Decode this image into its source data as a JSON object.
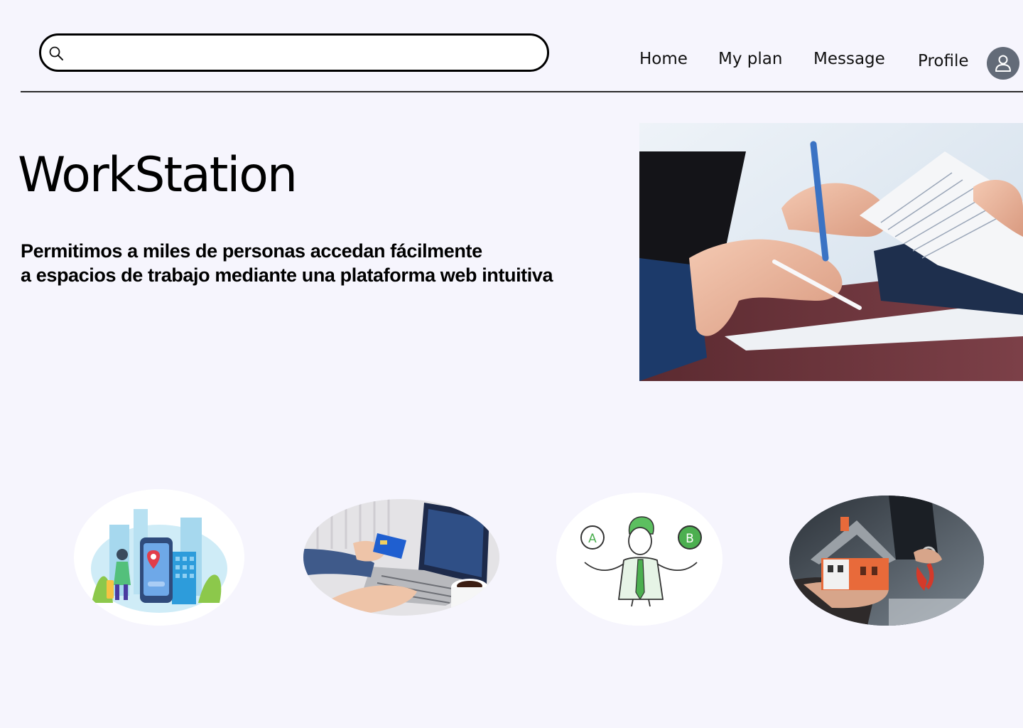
{
  "header": {
    "search": {
      "value": "",
      "placeholder": ""
    },
    "nav": {
      "home": "Home",
      "my_plan": "My plan",
      "message": "Message",
      "profile": "Profile"
    }
  },
  "hero": {
    "title": "WorkStation",
    "tagline_line1": "Permitimos a miles de personas accedan fácilmente",
    "tagline_line2": "a espacios de trabajo mediante una plataforma web intuitiva"
  },
  "features": [
    {
      "illustration": "location-map-illustration"
    },
    {
      "illustration": "online-payment-photo"
    },
    {
      "illustration": "decision-ab-illustration",
      "option_a": "A",
      "option_b": "B"
    },
    {
      "illustration": "house-keys-photo"
    }
  ],
  "icons": {
    "search": "search-icon",
    "avatar": "user-icon"
  },
  "colors": {
    "background": "#f6f5fd",
    "avatar": "#636b78",
    "choice_green": "#4caf50"
  }
}
